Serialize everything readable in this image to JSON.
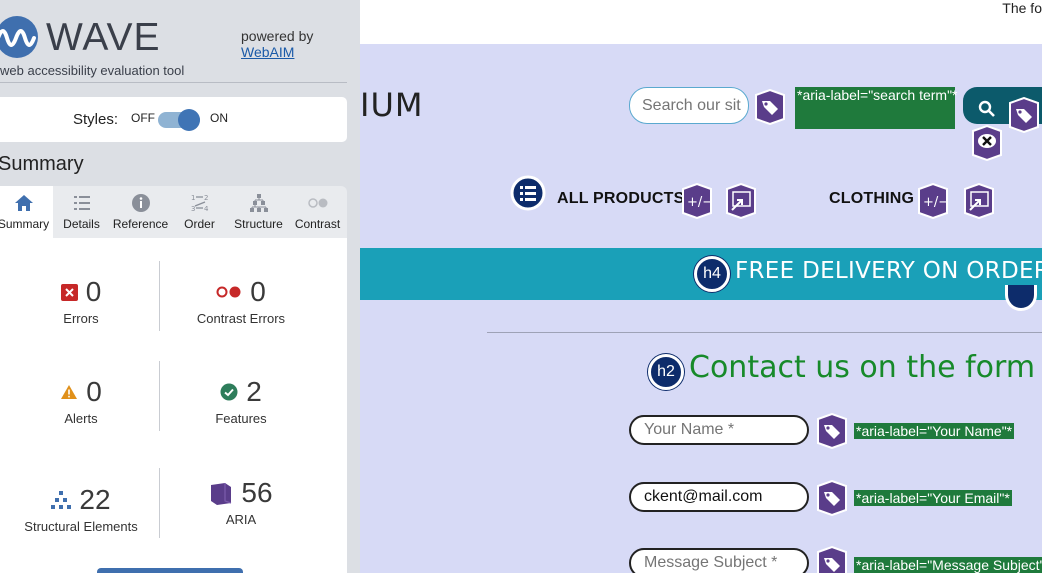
{
  "wave": {
    "logo_text": "WAVE",
    "subtitle": "web accessibility evaluation tool",
    "powered_by": "powered by",
    "webaim_link": "WebAIM",
    "styles_label": "Styles:",
    "styles_off": "OFF",
    "styles_on": "ON",
    "summary_heading": "Summary",
    "tabs": [
      {
        "label": "Summary",
        "icon": "home-icon"
      },
      {
        "label": "Details",
        "icon": "list-icon"
      },
      {
        "label": "Reference",
        "icon": "info-icon"
      },
      {
        "label": "Order",
        "icon": "order-icon"
      },
      {
        "label": "Structure",
        "icon": "structure-icon"
      },
      {
        "label": "Contrast",
        "icon": "contrast-icon"
      }
    ],
    "stats": {
      "errors": {
        "count": "0",
        "label": "Errors"
      },
      "contrast_errors": {
        "count": "0",
        "label": "Contrast Errors"
      },
      "alerts": {
        "count": "0",
        "label": "Alerts"
      },
      "features": {
        "count": "2",
        "label": "Features"
      },
      "structural": {
        "count": "22",
        "label": "Structural Elements"
      },
      "aria": {
        "count": "56",
        "label": "ARIA"
      }
    },
    "colors": {
      "error": "#c62828",
      "alert": "#e0901a",
      "feature": "#2e7d5b",
      "structure": "#3f6fae",
      "aria": "#5a3d8a"
    }
  },
  "page": {
    "top_strip_text": "The fo",
    "brand_fragment": "IUM",
    "search_placeholder": "Search our sit",
    "search_aria": "*aria-label=\"search term\"*",
    "nav": [
      {
        "label": "ALL PRODUCTS"
      },
      {
        "label": "CLOTHING"
      }
    ],
    "delivery_badge": "h4",
    "delivery_text": "FREE DELIVERY ON ORDERS",
    "contact_badge": "h2",
    "contact_heading": "Contact us on the form be",
    "form": [
      {
        "placeholder": "Your Name *",
        "value": "",
        "aria": "*aria-label=\"Your Name\"*"
      },
      {
        "placeholder": "",
        "value": "ckent@mail.com",
        "aria": "*aria-label=\"Your Email\"*"
      },
      {
        "placeholder": "Message Subject *",
        "value": "",
        "aria": "*aria-label=\"Message Subject\"*"
      }
    ],
    "colors": {
      "background": "#d7daf6",
      "band": "#1aa0b8",
      "heading_green": "#178a2a",
      "aria_tag": "#1f7a3c",
      "wave_icon": "#5a3d8a"
    }
  }
}
